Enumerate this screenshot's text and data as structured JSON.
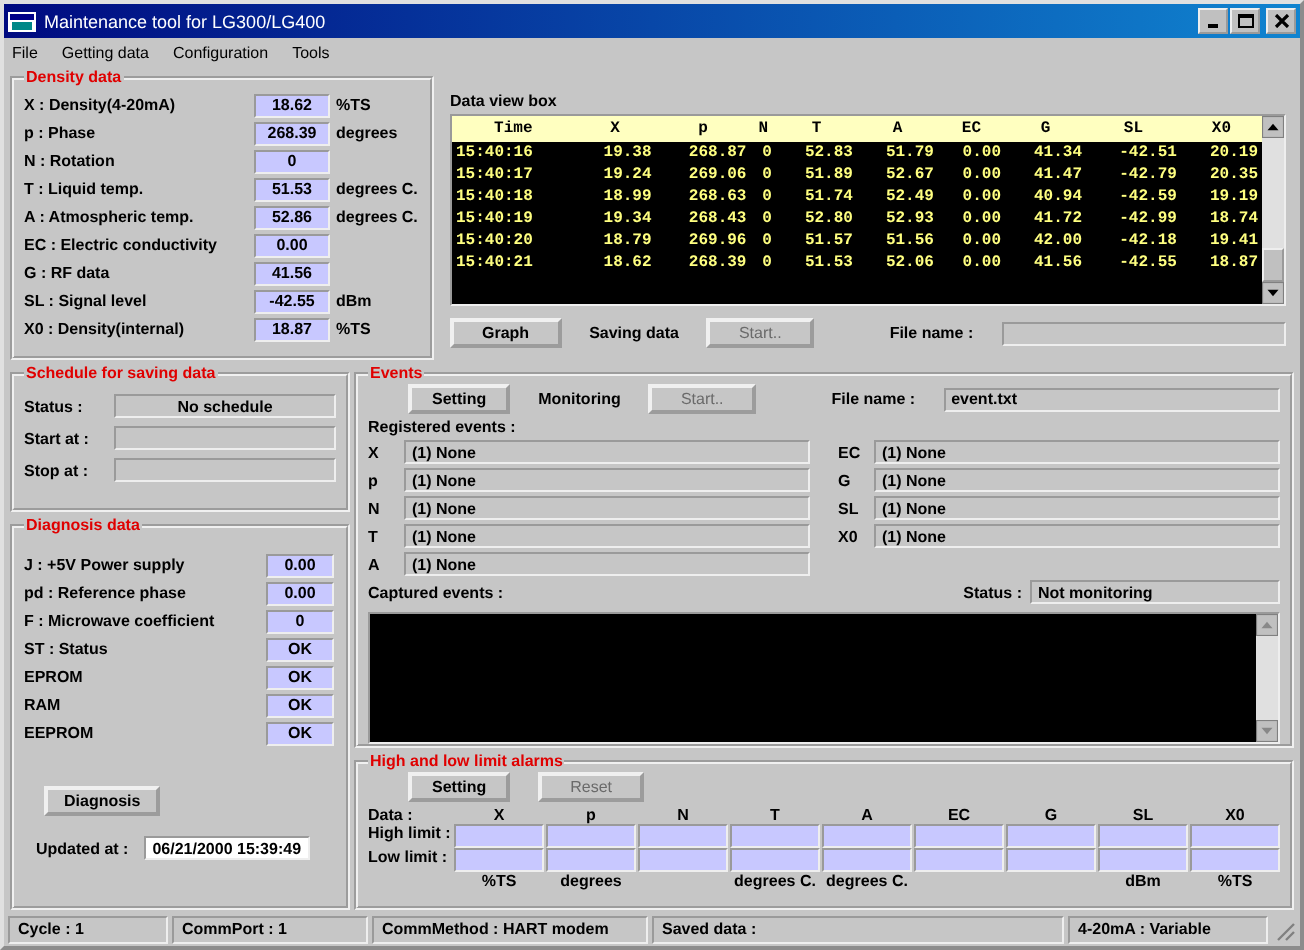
{
  "window": {
    "title": "Maintenance tool for LG300/LG400"
  },
  "menu": [
    "File",
    "Getting data",
    "Configuration",
    "Tools"
  ],
  "density_data": {
    "title": "Density data",
    "rows": [
      {
        "label": "X : Density(4-20mA)",
        "value": "18.62",
        "unit": "%TS"
      },
      {
        "label": "p : Phase",
        "value": "268.39",
        "unit": "degrees"
      },
      {
        "label": "N : Rotation",
        "value": "0"
      },
      {
        "label": "T : Liquid temp.",
        "value": "51.53",
        "unit": "degrees C."
      },
      {
        "label": "A : Atmospheric temp.",
        "value": "52.86",
        "unit": "degrees C."
      },
      {
        "label": "EC : Electric conductivity",
        "value": "0.00"
      },
      {
        "label": "G : RF data",
        "value": "41.56"
      },
      {
        "label": "SL : Signal level",
        "value": "-42.55",
        "unit": "dBm"
      },
      {
        "label": "X0 : Density(internal)",
        "value": "18.87",
        "unit": "%TS"
      }
    ]
  },
  "data_view": {
    "title": "Data view box",
    "columns": [
      "Time",
      "X",
      "p",
      "N",
      "T",
      "A",
      "EC",
      "G",
      "SL",
      "X0"
    ],
    "rows": [
      [
        "15:40:16",
        "19.38",
        "268.87",
        "0",
        "52.83",
        "51.79",
        "0.00",
        "41.34",
        "-42.51",
        "20.19"
      ],
      [
        "15:40:17",
        "19.24",
        "269.06",
        "0",
        "51.89",
        "52.67",
        "0.00",
        "41.47",
        "-42.79",
        "20.35"
      ],
      [
        "15:40:18",
        "18.99",
        "268.63",
        "0",
        "51.74",
        "52.49",
        "0.00",
        "40.94",
        "-42.59",
        "19.19"
      ],
      [
        "15:40:19",
        "19.34",
        "268.43",
        "0",
        "52.80",
        "52.93",
        "0.00",
        "41.72",
        "-42.99",
        "18.74"
      ],
      [
        "15:40:20",
        "18.79",
        "269.96",
        "0",
        "51.57",
        "51.56",
        "0.00",
        "42.00",
        "-42.18",
        "19.41"
      ],
      [
        "15:40:21",
        "18.62",
        "268.39",
        "0",
        "51.53",
        "52.06",
        "0.00",
        "41.56",
        "-42.55",
        "18.87"
      ]
    ],
    "graph_button": {
      "label": "Graph",
      "disabled": false
    },
    "saving_label": "Saving data",
    "start_button": {
      "label": "Start..",
      "disabled": true
    },
    "file_name_label": "File name :"
  },
  "schedule": {
    "title": "Schedule for saving data",
    "fields": [
      {
        "label": "Status :",
        "value": "No schedule"
      },
      {
        "label": "Start at :"
      },
      {
        "label": "Stop at :"
      }
    ]
  },
  "diagnosis": {
    "title": "Diagnosis data",
    "rows": [
      {
        "label": "J : +5V Power supply",
        "value": "0.00"
      },
      {
        "label": "pd : Reference phase",
        "value": "0.00"
      },
      {
        "label": "F : Microwave coefficient",
        "value": "0"
      },
      {
        "label": "ST : Status",
        "value": "OK"
      },
      {
        "label": "EPROM",
        "value": "OK"
      },
      {
        "label": "RAM",
        "value": "OK"
      },
      {
        "label": "EEPROM",
        "value": "OK"
      }
    ],
    "button": {
      "label": "Diagnosis",
      "disabled": false
    },
    "updated_label": "Updated at :",
    "updated_value": "06/21/2000 15:39:49"
  },
  "events": {
    "title": "Events",
    "setting_button": {
      "label": "Setting",
      "disabled": false
    },
    "monitoring_label": "Monitoring",
    "start_button": {
      "label": "Start..",
      "disabled": true
    },
    "file_name_label": "File name :",
    "file_name": "event.txt",
    "registered_label": "Registered events :",
    "left": [
      {
        "label": "X",
        "value": "(1) None"
      },
      {
        "label": "p",
        "value": "(1) None"
      },
      {
        "label": "N",
        "value": "(1) None"
      },
      {
        "label": "T",
        "value": "(1) None"
      },
      {
        "label": "A",
        "value": "(1) None"
      }
    ],
    "right": [
      {
        "label": "EC",
        "value": "(1) None"
      },
      {
        "label": "G",
        "value": "(1) None"
      },
      {
        "label": "SL",
        "value": "(1) None"
      },
      {
        "label": "X0",
        "value": "(1) None"
      }
    ],
    "captured_label": "Captured events :",
    "status_label": "Status :",
    "status": "Not monitoring"
  },
  "alarms": {
    "title": "High and low limit alarms",
    "setting_button": {
      "label": "Setting",
      "disabled": false
    },
    "reset_button": {
      "label": "Reset",
      "disabled": true
    },
    "data_label": "Data :",
    "high_label": "High limit :",
    "low_label": "Low limit :",
    "columns": [
      {
        "name": "X",
        "unit": "%TS"
      },
      {
        "name": "p",
        "unit": "degrees"
      },
      {
        "name": "N"
      },
      {
        "name": "T",
        "unit": "degrees C."
      },
      {
        "name": "A",
        "unit": "degrees C."
      },
      {
        "name": "EC"
      },
      {
        "name": "G"
      },
      {
        "name": "SL",
        "unit": "dBm"
      },
      {
        "name": "X0",
        "unit": "%TS"
      }
    ]
  },
  "status_bar": [
    "Cycle : 1",
    "CommPort : 1",
    "CommMethod : HART modem",
    "Saved data :",
    "4-20mA : Variable"
  ]
}
